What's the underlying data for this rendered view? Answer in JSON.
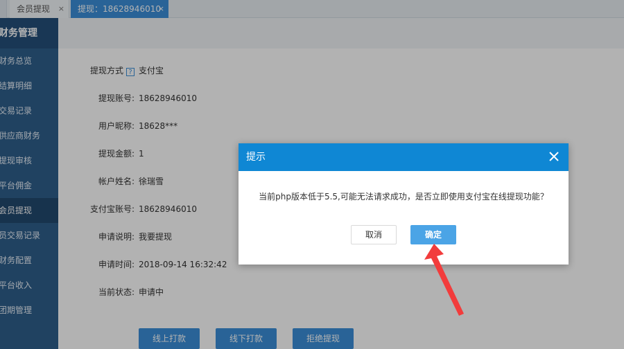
{
  "tabs": [
    {
      "label": "会员提现",
      "close": "×"
    },
    {
      "label": "提现：18628946010",
      "close": "×"
    }
  ],
  "sidebar": {
    "header": "财务管理",
    "items": [
      {
        "label": "财务总览"
      },
      {
        "label": "结算明细"
      },
      {
        "label": "交易记录"
      },
      {
        "label": "供应商财务"
      },
      {
        "label": "提现审核"
      },
      {
        "label": "平台佣金"
      },
      {
        "label": "会员提现",
        "active": true
      },
      {
        "label": "员交易记录"
      },
      {
        "label": "财务配置"
      },
      {
        "label": "平台收入"
      },
      {
        "label": "团期管理"
      }
    ]
  },
  "form": {
    "fields": [
      {
        "label": "提现方式",
        "value": "支付宝",
        "help_icon": "?"
      },
      {
        "label": "提现账号:",
        "value": "18628946010"
      },
      {
        "label": "用户昵称:",
        "value": "18628***"
      },
      {
        "label": "提现金额:",
        "value": "1"
      },
      {
        "label": "帐户姓名:",
        "value": "徐瑞雪"
      },
      {
        "label": "支付宝账号:",
        "value": "18628946010"
      },
      {
        "label": "申请说明:",
        "value": "我要提现"
      },
      {
        "label": "申请时间:",
        "value": "2018-09-14 16:32:42"
      },
      {
        "label": "当前状态:",
        "value": "申请中"
      }
    ],
    "actions": [
      {
        "label": "线上打款"
      },
      {
        "label": "线下打款"
      },
      {
        "label": "拒绝提现"
      }
    ]
  },
  "dialog": {
    "title": "提示",
    "message": "当前php版本低于5.5,可能无法请求成功，是否立即使用支付宝在线提现功能？",
    "cancel_label": "取消",
    "confirm_label": "确定"
  },
  "colors": {
    "dialog_header": "#0f87d4",
    "primary_button": "#3b8fd9",
    "sidebar": "#2f5f8c",
    "annotation_arrow": "#f23c3c"
  }
}
